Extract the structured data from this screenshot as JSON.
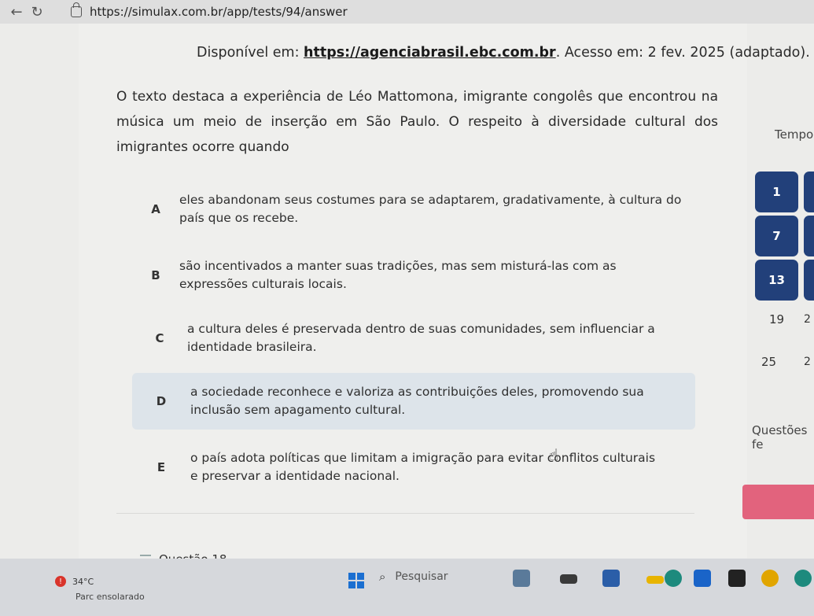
{
  "browser": {
    "back_icon": "←",
    "reload_icon": "↻",
    "url": "https://simulax.com.br/app/tests/94/answer"
  },
  "question": {
    "source_prefix": "Disponível em: ",
    "source_link": "https://agenciabrasil.ebc.com.br",
    "source_suffix": ". Acesso em: 2 fev. 2025 (adaptado).",
    "text": "O texto destaca a experiência de Léo Mattomona, imigrante congolês que encontrou na música um meio de inserção em São Paulo. O respeito à diversidade cultural dos imigrantes ocorre quando",
    "options": [
      {
        "letter": "A",
        "text": "eles abandonam seus costumes para se adaptarem, gradativamente, à cultura do país que os recebe."
      },
      {
        "letter": "B",
        "text": "são incentivados a manter suas tradições, mas sem misturá-las com as expressões culturais locais."
      },
      {
        "letter": "C",
        "text": "a cultura deles é preservada dentro de suas comunidades, sem influenciar a identidade brasileira."
      },
      {
        "letter": "D",
        "text": "a sociedade reconhece e valoriza as contribuições deles, promovendo sua inclusão sem apagamento cultural."
      },
      {
        "letter": "E",
        "text": "o país adota políticas que limitam a imigração para evitar conflitos culturais e preservar a identidade nacional."
      }
    ],
    "selected": "D"
  },
  "sidebar": {
    "tempo_label": "Tempo",
    "question_numbers": [
      "1",
      "7",
      "13",
      "19",
      "25"
    ],
    "row_edge_labels": [
      "2",
      "2"
    ],
    "questoes_label": "Questões fe"
  },
  "footer": {
    "question_label": "Questão 18"
  },
  "taskbar": {
    "weather_temp": "34°C",
    "weather_desc": "Parc ensolarado",
    "search_placeholder": "Pesquisar"
  },
  "colors": {
    "accent_navy": "#22407a",
    "selected_bg": "#dde4ea",
    "pink_button": "#e2637d"
  }
}
